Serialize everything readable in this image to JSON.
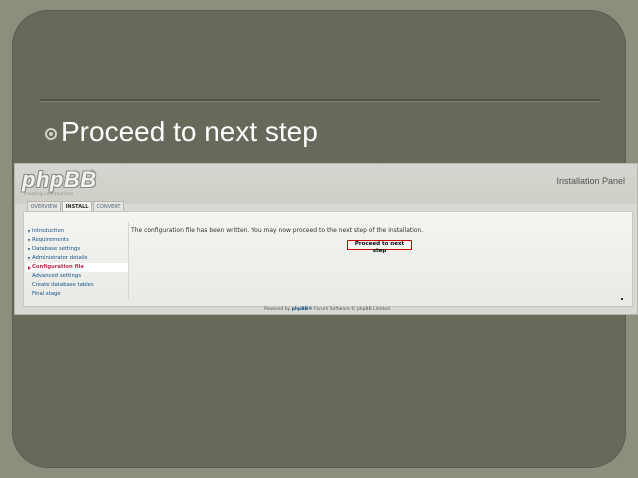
{
  "slide": {
    "heading": "Proceed to next step"
  },
  "phpbb": {
    "logo_text": "phpBB",
    "logo_reg": "®",
    "logo_tagline": "creating communities",
    "panel_title": "Installation Panel",
    "tabs": [
      {
        "label": "OVERVIEW"
      },
      {
        "label": "INSTALL"
      },
      {
        "label": "CONVERT"
      }
    ],
    "menu": [
      {
        "label": "Introduction"
      },
      {
        "label": "Requirements"
      },
      {
        "label": "Database settings"
      },
      {
        "label": "Administrator details"
      },
      {
        "label": "Configuration file"
      },
      {
        "label": "Advanced settings"
      },
      {
        "label": "Create database tables"
      },
      {
        "label": "Final stage"
      }
    ],
    "message": "The configuration file has been written. You may now proceed to the next step of the installation.",
    "proceed_button": "Proceed to next step",
    "footer_prefix": "Powered by ",
    "footer_brand": "phpBB®",
    "footer_suffix": " Forum Software © phpBB Limited"
  }
}
